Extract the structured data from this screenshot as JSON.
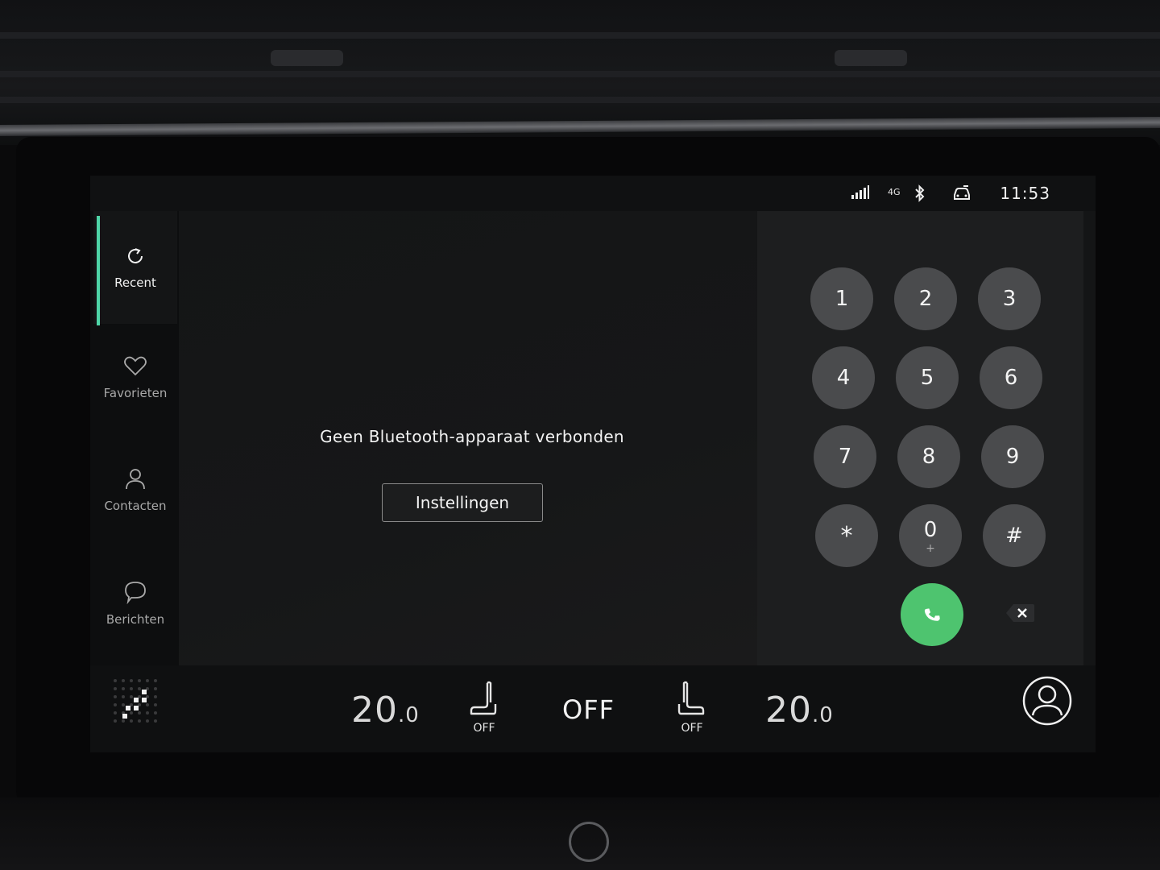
{
  "status_bar": {
    "network": "4G",
    "time": "11:53",
    "icons": [
      "signal-icon",
      "network-4g-icon",
      "bluetooth-icon",
      "car-icon"
    ]
  },
  "sidebar": {
    "items": [
      {
        "label": "Recent",
        "icon": "refresh-icon",
        "active": true
      },
      {
        "label": "Favorieten",
        "icon": "heart-icon",
        "active": false
      },
      {
        "label": "Contacten",
        "icon": "person-icon",
        "active": false
      },
      {
        "label": "Berichten",
        "icon": "chat-bubble-icon",
        "active": false
      }
    ]
  },
  "main": {
    "message": "Geen Bluetooth-apparaat verbonden",
    "settings_button": "Instellingen"
  },
  "keypad": {
    "keys": [
      {
        "label": "1",
        "sub": ""
      },
      {
        "label": "2",
        "sub": ""
      },
      {
        "label": "3",
        "sub": ""
      },
      {
        "label": "4",
        "sub": ""
      },
      {
        "label": "5",
        "sub": ""
      },
      {
        "label": "6",
        "sub": ""
      },
      {
        "label": "7",
        "sub": ""
      },
      {
        "label": "8",
        "sub": ""
      },
      {
        "label": "9",
        "sub": ""
      },
      {
        "label": "*",
        "sub": ""
      },
      {
        "label": "0",
        "sub": "+"
      },
      {
        "label": "#",
        "sub": ""
      }
    ],
    "call_icon": "phone-icon",
    "backspace_icon": "backspace-icon"
  },
  "climate": {
    "left_temp": "20",
    "left_temp_dec": ".0",
    "left_seat_label": "OFF",
    "fan": "OFF",
    "right_seat_label": "OFF",
    "right_temp": "20",
    "right_temp_dec": ".0"
  },
  "colors": {
    "accent": "#4fd6a8",
    "call": "#4ec46f",
    "key": "#4a4b4d",
    "background": "#141516"
  }
}
